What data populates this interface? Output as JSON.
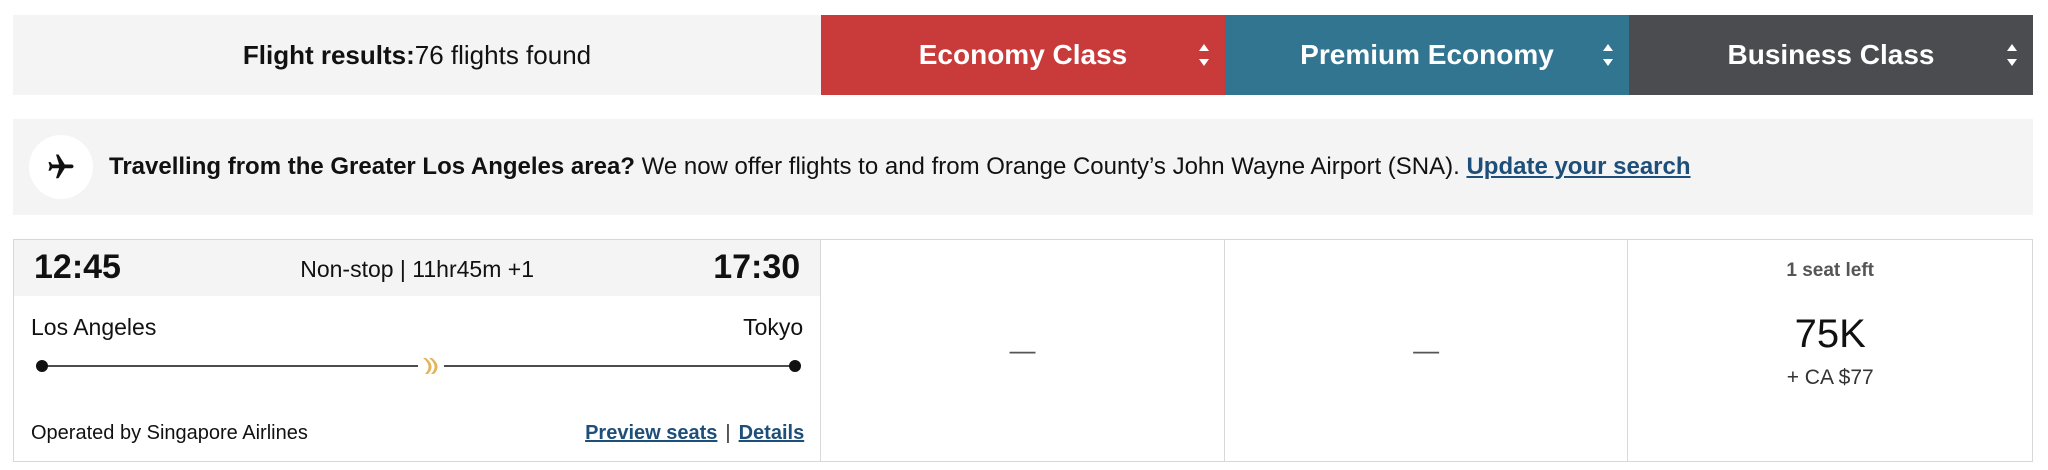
{
  "header": {
    "results_label": "Flight results:",
    "results_count": "76 flights found",
    "tabs": [
      {
        "label": "Economy Class",
        "color": "#c93a3a"
      },
      {
        "label": "Premium Economy",
        "color": "#317590"
      },
      {
        "label": "Business Class",
        "color": "#4a4c50"
      }
    ]
  },
  "banner": {
    "icon": "airplane-icon",
    "bold_text": "Travelling from the Greater Los Angeles area?",
    "text": " We now offer flights to and from Orange County’s John Wayne Airport (SNA). ",
    "link": "Update your search"
  },
  "flight": {
    "departure_time": "12:45",
    "arrival_time": "17:30",
    "duration": "Non-stop | 11hr45m +1",
    "departure_city": "Los Angeles",
    "arrival_city": "Tokyo",
    "operator": "Operated by Singapore Airlines",
    "preview_seats": "Preview seats",
    "separator": "|",
    "details": "Details",
    "fares": {
      "economy": "—",
      "premium": "—",
      "business": {
        "seats_left": "1 seat left",
        "points": "75K",
        "cash": "+ CA $77"
      }
    }
  }
}
